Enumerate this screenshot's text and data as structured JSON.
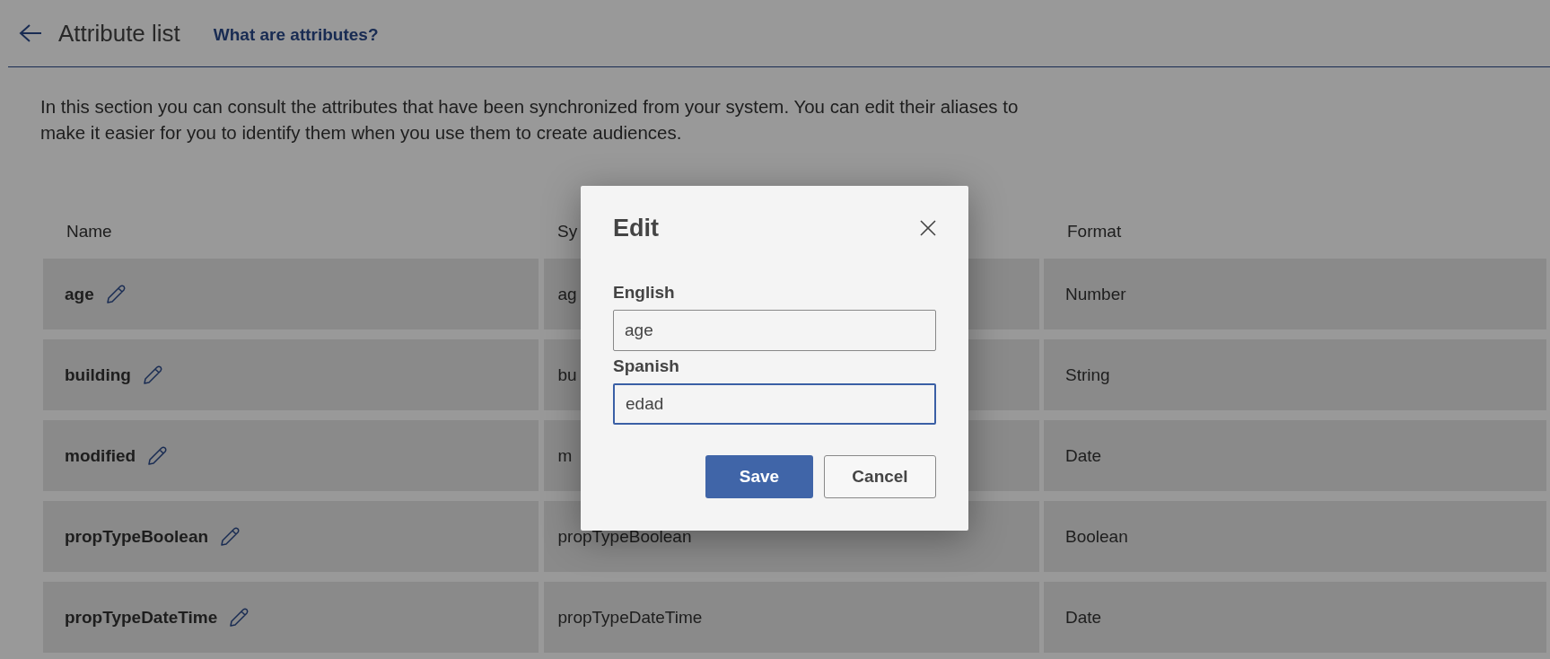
{
  "header": {
    "title": "Attribute list",
    "help_link": "What are attributes?"
  },
  "description": "In this section you can consult the attributes that have been synchronized from your system. You can edit their aliases to make it easier for you to identify them when you use them to create audiences.",
  "table": {
    "columns": [
      "Name",
      "Sy",
      "Format"
    ],
    "rows": [
      {
        "name": "age",
        "system_name": "ag",
        "format": "Number"
      },
      {
        "name": "building",
        "system_name": "bu",
        "format": "String"
      },
      {
        "name": "modified",
        "system_name": "m",
        "format": "Date"
      },
      {
        "name": "propTypeBoolean",
        "system_name": "propTypeBoolean",
        "format": "Boolean"
      },
      {
        "name": "propTypeDateTime",
        "system_name": "propTypeDateTime",
        "format": "Date"
      }
    ]
  },
  "dialog": {
    "title": "Edit",
    "fields": [
      {
        "label": "English",
        "value": "age",
        "focused": false
      },
      {
        "label": "Spanish",
        "value": "edad",
        "focused": true
      }
    ],
    "buttons": [
      {
        "label": "Save",
        "kind": "primary"
      },
      {
        "label": "Cancel",
        "kind": "secondary"
      }
    ]
  }
}
